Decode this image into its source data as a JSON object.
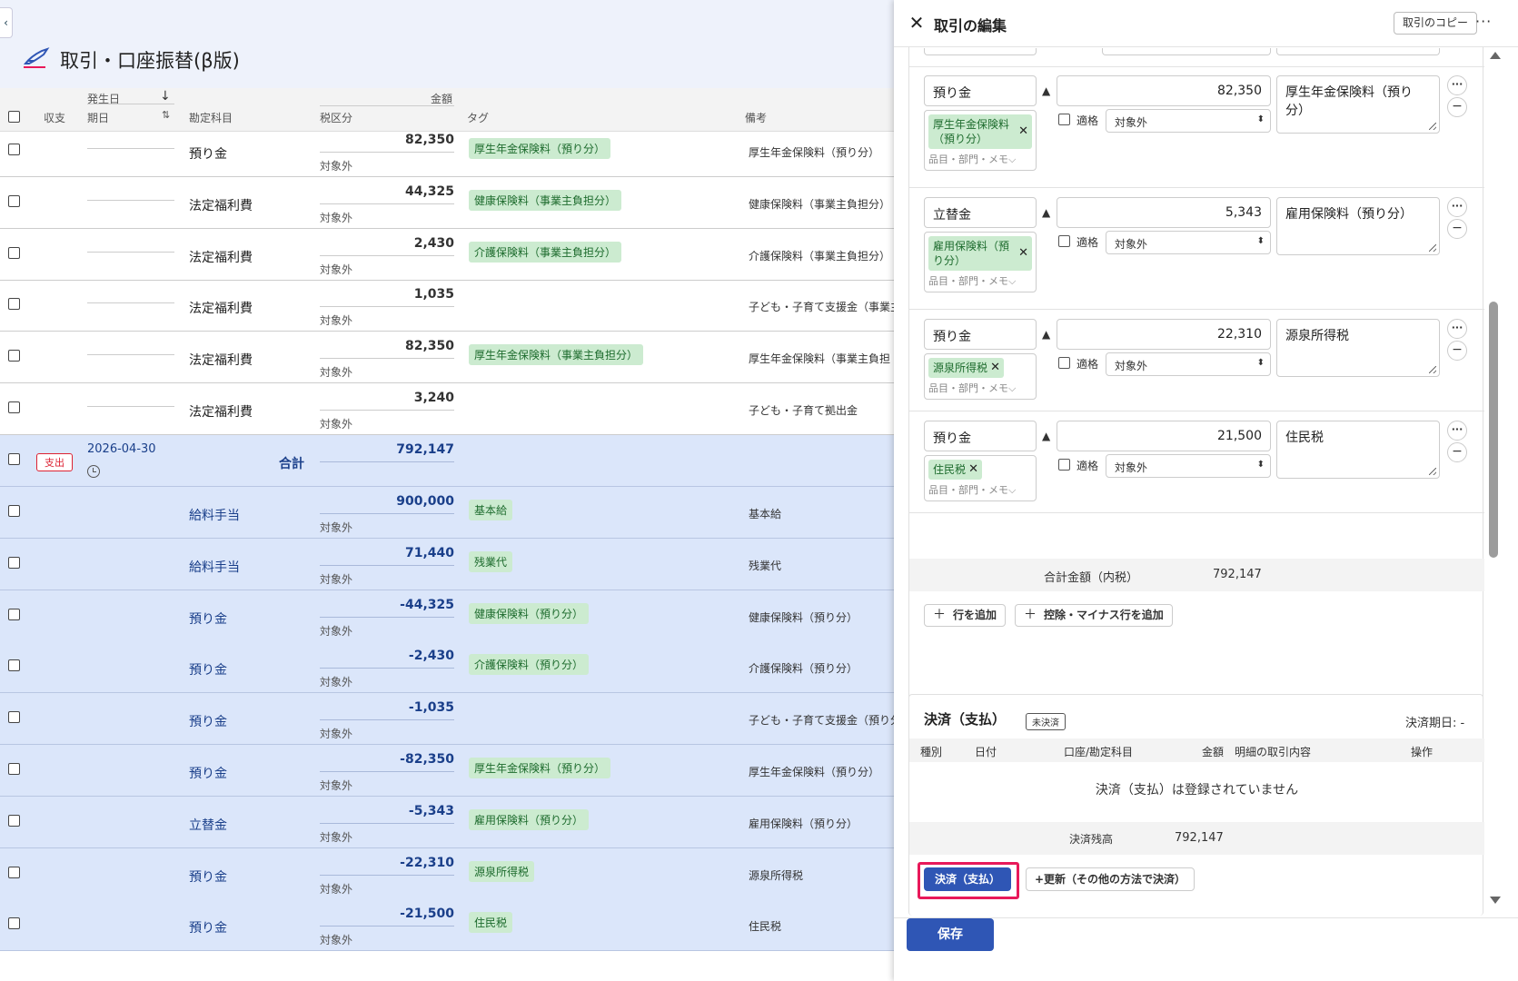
{
  "page": {
    "title": "取引・口座振替(β版)"
  },
  "table": {
    "headers": {
      "occur_date": "発生日",
      "income_expense": "収支",
      "period": "期日",
      "account": "勘定科目",
      "amount": "金額",
      "tax": "税区分",
      "tag": "タグ",
      "memo": "備考"
    },
    "rows_top": [
      {
        "account": "預り金",
        "amount": "82,350",
        "tax": "対象外",
        "tag": "厚生年金保険料（預り分）",
        "memo": "厚生年金保険料（預り分）"
      },
      {
        "account": "法定福利費",
        "amount": "44,325",
        "tax": "対象外",
        "tag": "健康保険料（事業主負担分）",
        "memo": "健康保険料（事業主負担分）"
      },
      {
        "account": "法定福利費",
        "amount": "2,430",
        "tax": "対象外",
        "tag": "介護保険料（事業主負担分）",
        "memo": "介護保険料（事業主負担分）"
      },
      {
        "account": "法定福利費",
        "amount": "1,035",
        "tax": "対象外",
        "tag": "",
        "memo": "子ども・子育て支援金（事業主"
      },
      {
        "account": "法定福利費",
        "amount": "82,350",
        "tax": "対象外",
        "tag": "厚生年金保険料（事業主負担分）",
        "memo": "厚生年金保険料（事業主負担"
      },
      {
        "account": "法定福利費",
        "amount": "3,240",
        "tax": "対象外",
        "tag": "",
        "memo": "子ども・子育て拠出金"
      }
    ],
    "total_row": {
      "badge": "支出",
      "date": "2026-04-30",
      "label": "合計",
      "amount": "792,147"
    },
    "rows_bottom": [
      {
        "account": "給料手当",
        "amount": "900,000",
        "tax": "対象外",
        "tag": "基本給",
        "memo": "基本給"
      },
      {
        "account": "給料手当",
        "amount": "71,440",
        "tax": "対象外",
        "tag": "残業代",
        "memo": "残業代"
      },
      {
        "account": "預り金",
        "amount": "-44,325",
        "tax": "対象外",
        "tag": "健康保険料（預り分）",
        "memo": "健康保険料（預り分）"
      },
      {
        "account": "預り金",
        "amount": "-2,430",
        "tax": "対象外",
        "tag": "介護保険料（預り分）",
        "memo": "介護保険料（預り分）"
      },
      {
        "account": "預り金",
        "amount": "-1,035",
        "tax": "対象外",
        "tag": "",
        "memo": "子ども・子育て支援金（預り分"
      },
      {
        "account": "預り金",
        "amount": "-82,350",
        "tax": "対象外",
        "tag": "厚生年金保険料（預り分）",
        "memo": "厚生年金保険料（預り分）"
      },
      {
        "account": "立替金",
        "amount": "-5,343",
        "tax": "対象外",
        "tag": "雇用保険料（預り分）",
        "memo": "雇用保険料（預り分）"
      },
      {
        "account": "預り金",
        "amount": "-22,310",
        "tax": "対象外",
        "tag": "源泉所得税",
        "memo": "源泉所得税"
      },
      {
        "account": "預り金",
        "amount": "-21,500",
        "tax": "対象外",
        "tag": "住民税",
        "memo": "住民税"
      }
    ]
  },
  "panel": {
    "title": "取引の編集",
    "copy_label": "取引のコピー",
    "more_label": "···",
    "lines": [
      {
        "account": "預り金",
        "amount": "82,350",
        "chip": "厚生年金保険料（預り分）",
        "sub": "品目・部門・メモ⌵",
        "qualified": "適格",
        "tax": "対象外",
        "memo": "厚生年金保険料（預り分）"
      },
      {
        "account": "立替金",
        "amount": "5,343",
        "chip": "雇用保険料（預り分）",
        "sub": "品目・部門・メモ⌵",
        "qualified": "適格",
        "tax": "対象外",
        "memo": "雇用保険料（預り分）"
      },
      {
        "account": "預り金",
        "amount": "22,310",
        "chip": "源泉所得税",
        "sub": "品目・部門・メモ⌵",
        "qualified": "適格",
        "tax": "対象外",
        "memo": "源泉所得税"
      },
      {
        "account": "預り金",
        "amount": "21,500",
        "chip": "住民税",
        "sub": "品目・部門・メモ⌵",
        "qualified": "適格",
        "tax": "対象外",
        "memo": "住民税"
      }
    ],
    "sum_label": "合計金額（内税）",
    "sum_value": "792,147",
    "add_row": "行を追加",
    "add_minus_row": "控除・マイナス行を追加",
    "settlement": {
      "title": "決済（支払）",
      "status": "未決済",
      "due": "決済期日: -",
      "headers": [
        "種別",
        "日付",
        "口座/勘定科目",
        "金額",
        "明細の取引内容",
        "操作"
      ],
      "empty": "決済（支払）は登録されていません",
      "balance_label": "決済残高",
      "balance_value": "792,147",
      "pay_button": "決済（支払）",
      "update_button": "+更新（その他の方法で決済）"
    },
    "save": "保存"
  }
}
